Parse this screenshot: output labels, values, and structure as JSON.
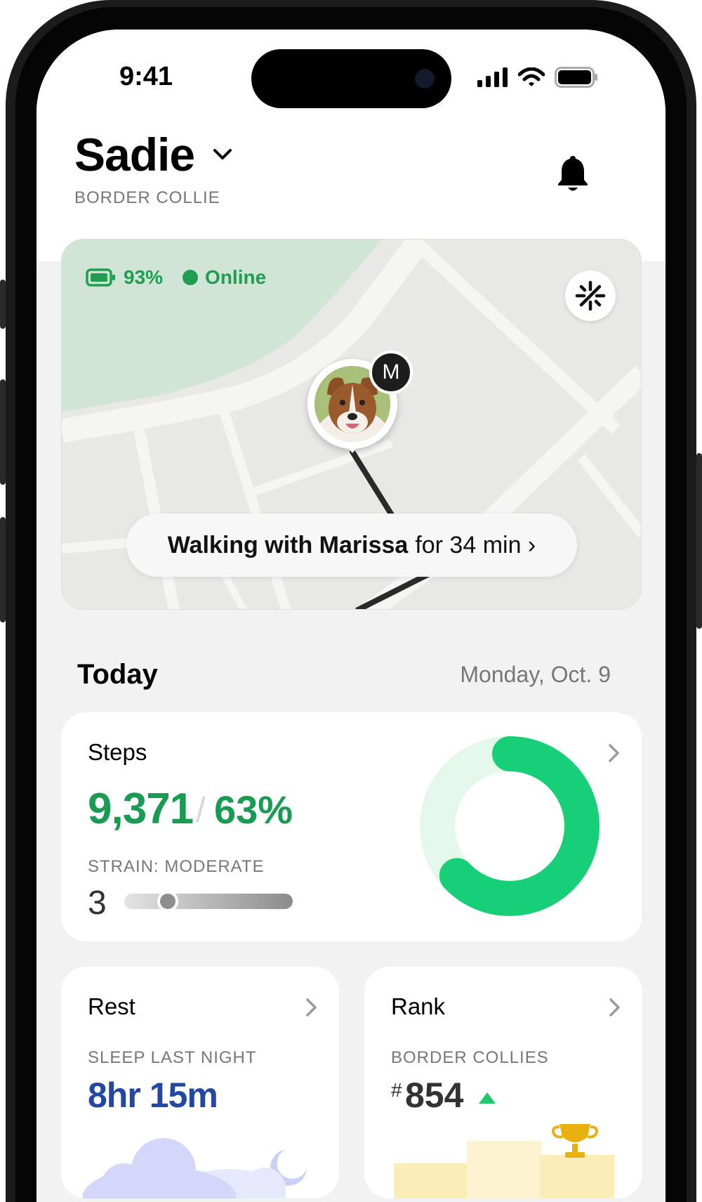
{
  "status_bar": {
    "time": "9:41"
  },
  "header": {
    "pet_name": "Sadie",
    "breed": "BORDER COLLIE"
  },
  "map": {
    "battery": "93%",
    "connection": "Online",
    "walker_initial": "M",
    "walk_person": "Walking with Marissa",
    "walk_duration": "for 34 min ›"
  },
  "today": {
    "label": "Today",
    "date": "Monday, Oct. 9"
  },
  "steps": {
    "title": "Steps",
    "count": "9,371",
    "separator": "/",
    "percent_label": "63%",
    "progress": 0.63,
    "strain_label": "STRAIN: MODERATE",
    "strain_value": "3",
    "strain_level": 0.26
  },
  "rest": {
    "title": "Rest",
    "sub_label": "SLEEP LAST NIGHT",
    "value": "8hr 15m"
  },
  "rank": {
    "title": "Rank",
    "sub_label": "BORDER COLLIES",
    "hash": "#",
    "value": "854"
  },
  "colors": {
    "accent_green": "#1a9b53",
    "ring_green": "#17cf77",
    "rest_blue": "#2348a4"
  },
  "icons": [
    "chevron-down-icon",
    "bell-icon",
    "battery-icon",
    "recenter-icon",
    "chevron-right-icon",
    "trophy-icon",
    "moon-icon",
    "cloud-icon"
  ]
}
